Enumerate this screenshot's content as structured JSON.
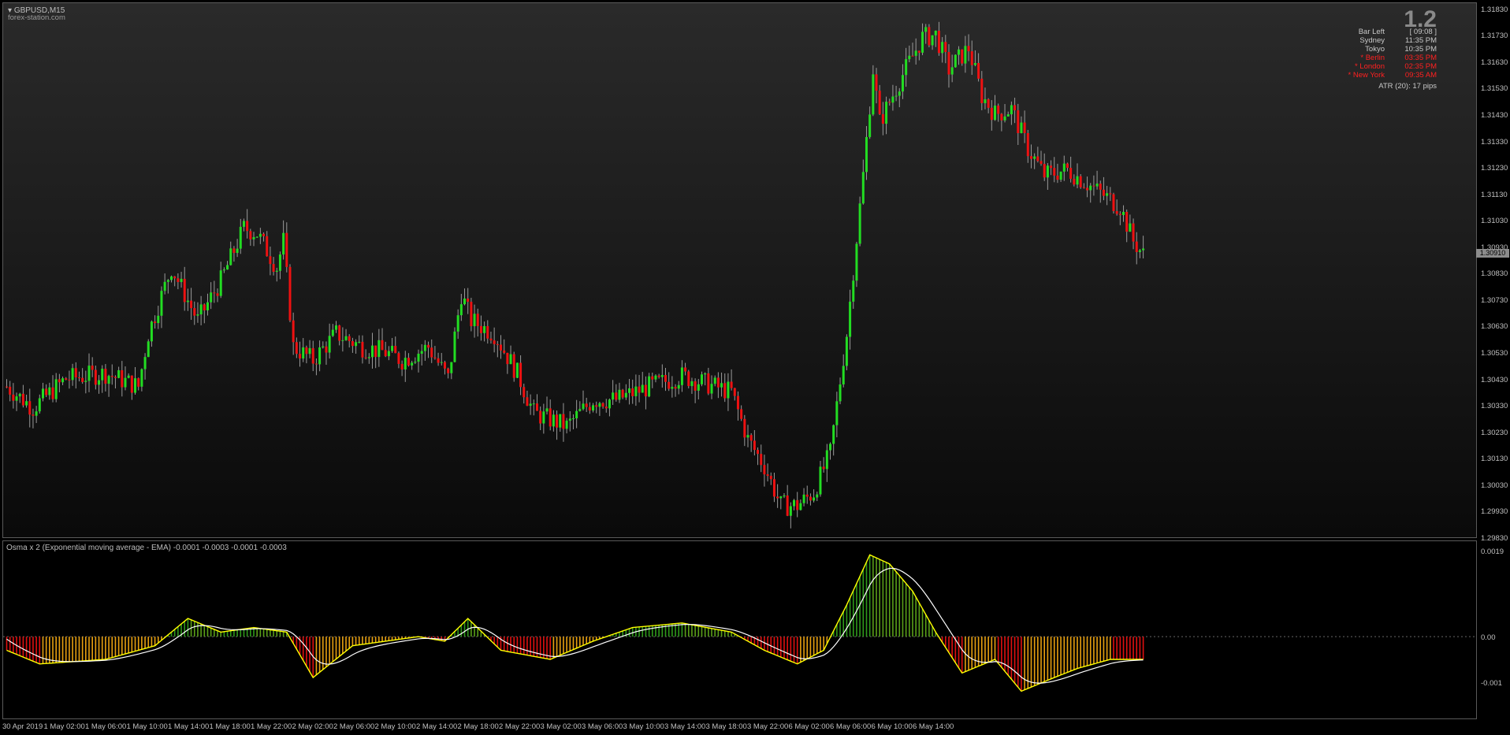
{
  "window": {
    "symbol_title": "GBPUSD,M15",
    "watermark": "forex-station.com"
  },
  "info_panel": {
    "spread": "1.2",
    "rows": [
      {
        "label": "Bar Left",
        "value": "[ 09:08 ]",
        "color": "#c8c8c8"
      },
      {
        "label": "Sydney",
        "value": "11:35 PM",
        "color": "#c8c8c8"
      },
      {
        "label": "Tokyo",
        "value": "10:35 PM",
        "color": "#c8c8c8"
      },
      {
        "label": "* Berlin",
        "value": "03:35 PM",
        "color": "#ff2020"
      },
      {
        "label": "* London",
        "value": "02:35 PM",
        "color": "#ff2020"
      },
      {
        "label": "* New York",
        "value": "09:35 AM",
        "color": "#ff2020"
      }
    ],
    "atr": "ATR (20): 17 pips"
  },
  "price_scale": {
    "labels": [
      "1.31830",
      "1.31730",
      "1.31630",
      "1.31530",
      "1.31430",
      "1.31330",
      "1.31230",
      "1.31130",
      "1.31030",
      "1.30930",
      "1.30830",
      "1.30730",
      "1.30630",
      "1.30530",
      "1.30430",
      "1.30330",
      "1.30230",
      "1.30130",
      "1.30030",
      "1.29930",
      "1.29830"
    ],
    "current_price": "1.30910"
  },
  "indicator": {
    "title": "Osma x 2 (Exponential moving average - EMA) -0.0001 -0.0003 -0.0001 -0.0003",
    "scale_labels": [
      "0.0019",
      "0.00",
      "-0.001"
    ]
  },
  "time_axis": {
    "labels": [
      "30 Apr 2019",
      "1 May 02:00",
      "1 May 06:00",
      "1 May 10:00",
      "1 May 14:00",
      "1 May 18:00",
      "1 May 22:00",
      "2 May 02:00",
      "2 May 06:00",
      "2 May 10:00",
      "2 May 14:00",
      "2 May 18:00",
      "2 May 22:00",
      "3 May 02:00",
      "3 May 06:00",
      "3 May 10:00",
      "3 May 14:00",
      "3 May 18:00",
      "3 May 22:00",
      "6 May 02:00",
      "6 May 06:00",
      "6 May 10:00",
      "6 May 14:00"
    ]
  },
  "colors": {
    "bull": "#22dd22",
    "bear": "#ee1111",
    "osma_up": "#2f9a1a",
    "osma_down": "#e01010",
    "osma_fade": "#e8a010",
    "signal_line": "#ffff00",
    "osma_line": "#ffffff"
  },
  "chart_data": {
    "type": "candlestick",
    "ylim": [
      1.2983,
      1.3185
    ],
    "anchors": [
      [
        0,
        1.304
      ],
      [
        8,
        1.3032
      ],
      [
        18,
        1.3043
      ],
      [
        30,
        1.3045
      ],
      [
        40,
        1.304
      ],
      [
        43,
        1.306
      ],
      [
        50,
        1.3085
      ],
      [
        58,
        1.3065
      ],
      [
        65,
        1.308
      ],
      [
        72,
        1.31
      ],
      [
        76,
        1.3098
      ],
      [
        82,
        1.3085
      ],
      [
        84,
        1.3095
      ],
      [
        87,
        1.3055
      ],
      [
        93,
        1.305
      ],
      [
        100,
        1.306
      ],
      [
        108,
        1.3055
      ],
      [
        115,
        1.3053
      ],
      [
        120,
        1.305
      ],
      [
        128,
        1.3055
      ],
      [
        134,
        1.3043
      ],
      [
        138,
        1.3075
      ],
      [
        141,
        1.3065
      ],
      [
        148,
        1.306
      ],
      [
        155,
        1.3045
      ],
      [
        160,
        1.303
      ],
      [
        170,
        1.3025
      ],
      [
        178,
        1.3035
      ],
      [
        185,
        1.3035
      ],
      [
        195,
        1.304
      ],
      [
        205,
        1.3044
      ],
      [
        215,
        1.304
      ],
      [
        220,
        1.3038
      ],
      [
        225,
        1.302
      ],
      [
        230,
        1.301
      ],
      [
        235,
        1.2995
      ],
      [
        240,
        1.2995
      ],
      [
        245,
        1.3
      ],
      [
        250,
        1.3015
      ],
      [
        255,
        1.306
      ],
      [
        260,
        1.312
      ],
      [
        263,
        1.316
      ],
      [
        265,
        1.314
      ],
      [
        272,
        1.3158
      ],
      [
        278,
        1.3172
      ],
      [
        282,
        1.3173
      ],
      [
        286,
        1.316
      ],
      [
        292,
        1.3168
      ],
      [
        296,
        1.315
      ],
      [
        300,
        1.3143
      ],
      [
        305,
        1.3145
      ],
      [
        310,
        1.313
      ],
      [
        315,
        1.312
      ],
      [
        322,
        1.3122
      ],
      [
        330,
        1.3115
      ],
      [
        338,
        1.3108
      ],
      [
        342,
        1.3095
      ],
      [
        345,
        1.309
      ]
    ],
    "osma_anchors": [
      [
        0,
        -0.0003
      ],
      [
        10,
        -0.0006
      ],
      [
        30,
        -0.0005
      ],
      [
        45,
        -0.0002
      ],
      [
        55,
        0.0004
      ],
      [
        65,
        0.0001
      ],
      [
        75,
        0.0002
      ],
      [
        85,
        0.0001
      ],
      [
        93,
        -0.0009
      ],
      [
        105,
        -0.0002
      ],
      [
        125,
        0.0
      ],
      [
        133,
        -0.0001
      ],
      [
        140,
        0.0004
      ],
      [
        150,
        -0.0003
      ],
      [
        165,
        -0.0005
      ],
      [
        178,
        -0.0001
      ],
      [
        190,
        0.0002
      ],
      [
        205,
        0.0003
      ],
      [
        220,
        0.0001
      ],
      [
        230,
        -0.0003
      ],
      [
        240,
        -0.0006
      ],
      [
        248,
        -0.0003
      ],
      [
        255,
        0.0007
      ],
      [
        262,
        0.0018
      ],
      [
        268,
        0.0016
      ],
      [
        275,
        0.001
      ],
      [
        282,
        0.0001
      ],
      [
        290,
        -0.0008
      ],
      [
        300,
        -0.0005
      ],
      [
        308,
        -0.0012
      ],
      [
        318,
        -0.0009
      ],
      [
        325,
        -0.0007
      ],
      [
        335,
        -0.0005
      ],
      [
        345,
        -0.0005
      ]
    ],
    "indicator_ylim": [
      -0.0018,
      0.0021
    ]
  }
}
